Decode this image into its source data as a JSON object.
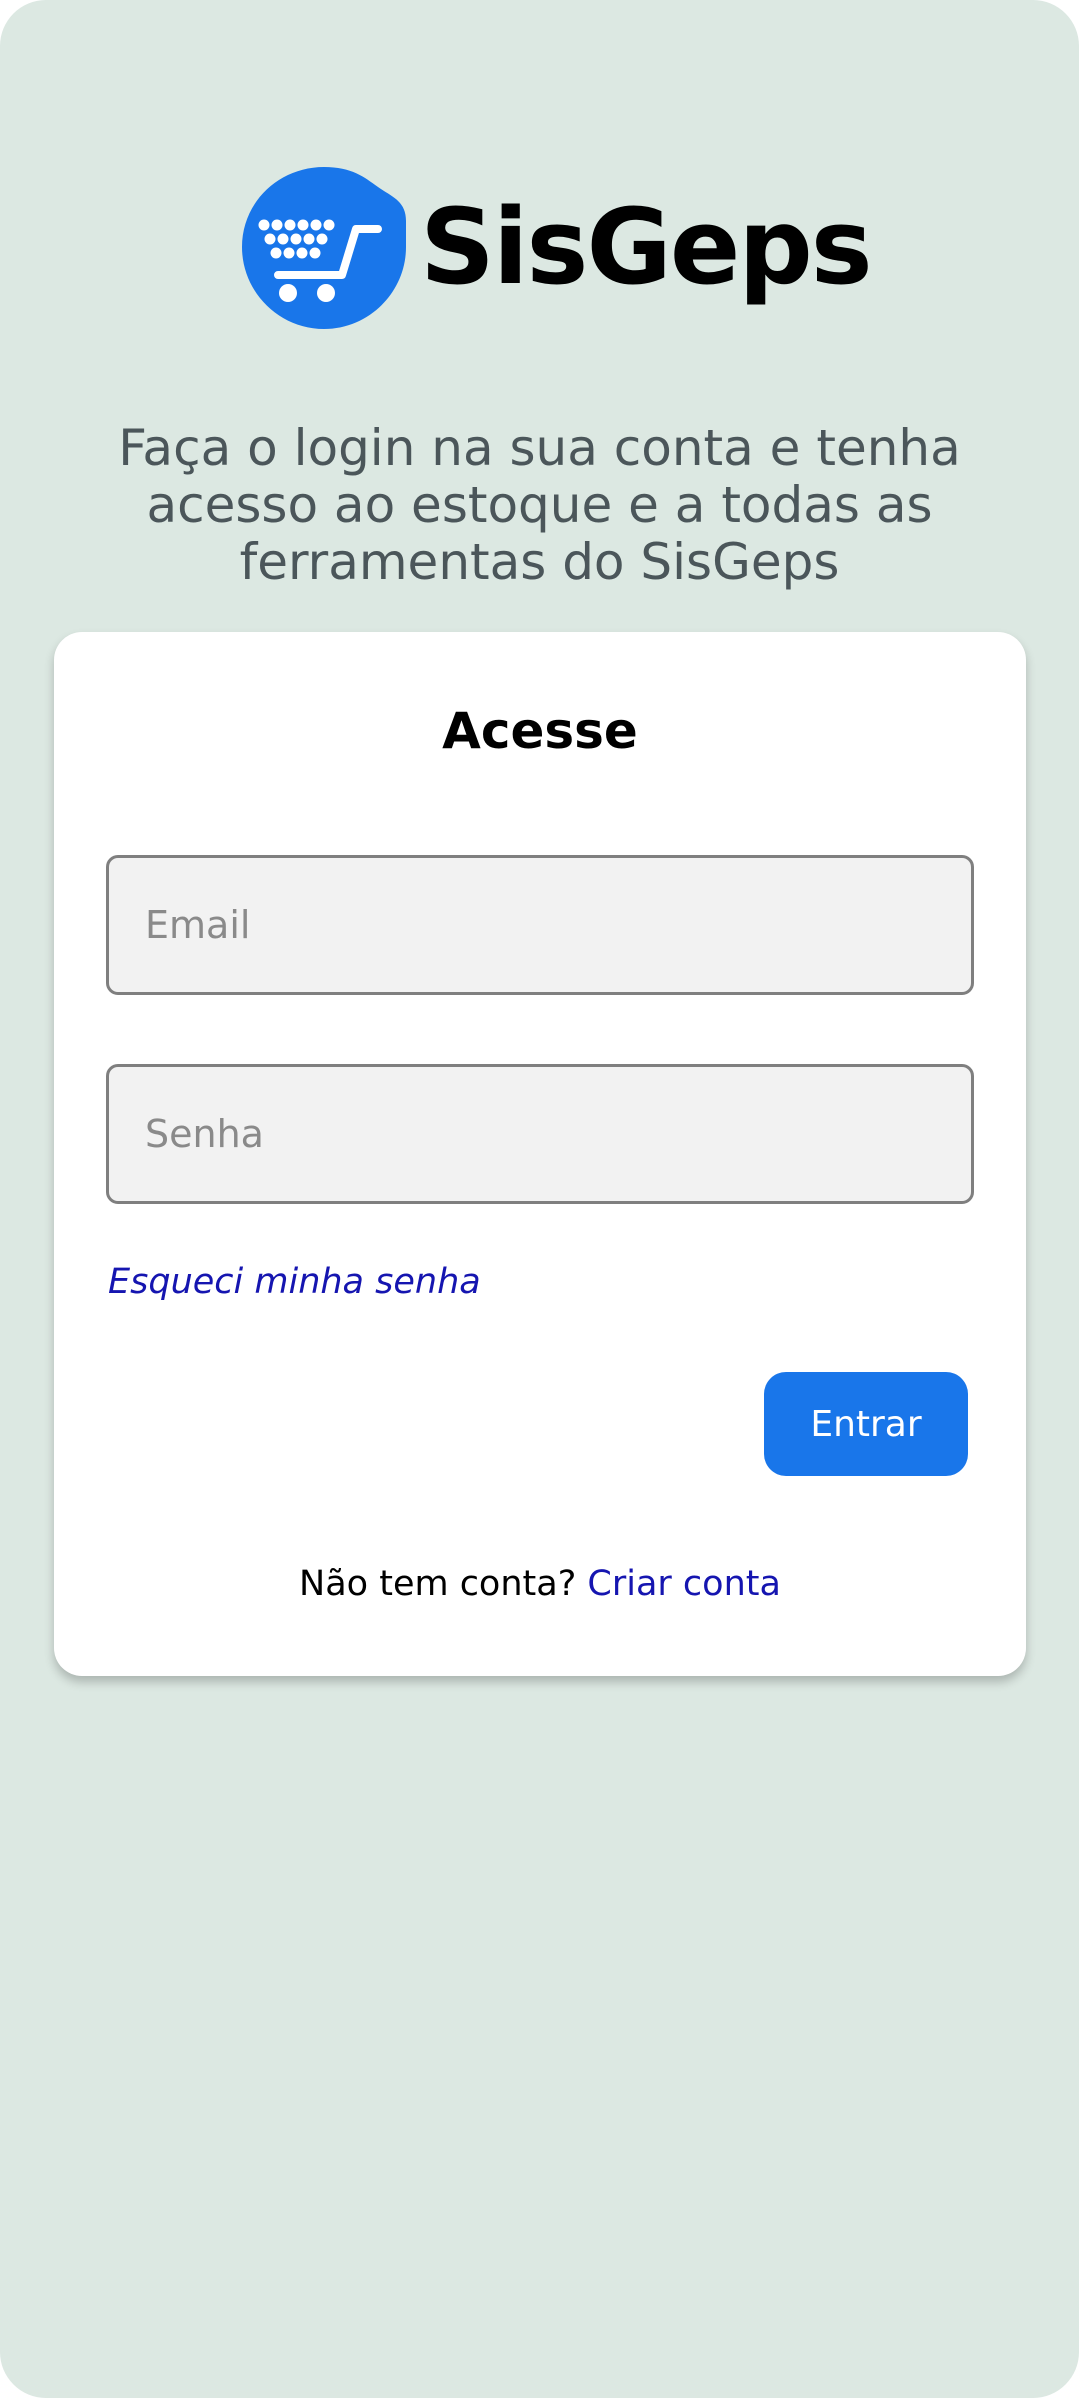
{
  "brand": {
    "name": "SisGeps",
    "logo_icon": "shopping-cart-icon",
    "accent_color": "#1976ea"
  },
  "intro": {
    "text": "Faça o login na sua conta e tenha acesso ao estoque e a todas as ferramentas do SisGeps"
  },
  "login_card": {
    "title": "Acesse",
    "email_placeholder": "Email",
    "email_value": "",
    "password_placeholder": "Senha",
    "password_value": "",
    "forgot_password_label": "Esqueci minha senha",
    "submit_label": "Entrar",
    "signup_prompt": "Não tem conta?",
    "signup_link_label": "Criar conta"
  },
  "colors": {
    "background": "#dce8e2",
    "link": "#1515b0",
    "button": "#1976ea"
  }
}
